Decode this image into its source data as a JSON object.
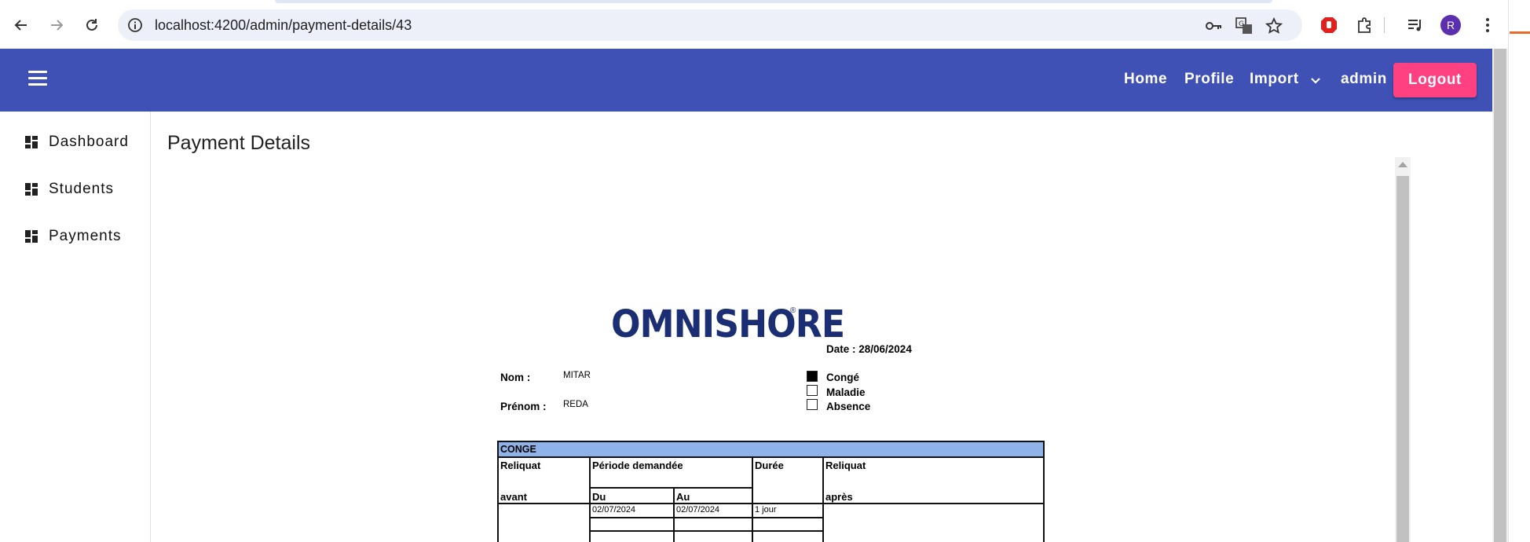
{
  "browser": {
    "url": "localhost:4200/admin/payment-details/43",
    "avatar_letter": "R",
    "icons": [
      "back-icon",
      "forward-icon",
      "reload-icon",
      "site-info-icon",
      "password-key-icon",
      "translate-icon",
      "bookmark-star-icon",
      "adblock-icon",
      "extensions-icon",
      "media-control-icon",
      "profile-avatar",
      "more-menu-icon"
    ]
  },
  "appbar": {
    "nav": {
      "home": "Home",
      "profile": "Profile",
      "import": "Import",
      "user": "admin",
      "logout": "Logout"
    },
    "colors": {
      "primary": "#3f51b5",
      "accent": "#ff4081"
    }
  },
  "sidebar": {
    "items": [
      {
        "label": "Dashboard",
        "icon": "dashboard-icon"
      },
      {
        "label": "Students",
        "icon": "dashboard-icon"
      },
      {
        "label": "Payments",
        "icon": "dashboard-icon"
      }
    ]
  },
  "main": {
    "title": "Payment Details"
  },
  "document": {
    "logo": "OMNISHORE",
    "logo_mark": "®",
    "date": "Date : 28/06/2024",
    "nom_label": "Nom :",
    "nom_value": "MITAR",
    "prenom_label": "Prénom :",
    "prenom_value": "REDA",
    "types": [
      {
        "label": "Congé",
        "checked": true
      },
      {
        "label": "Maladie",
        "checked": false
      },
      {
        "label": "Absence",
        "checked": false
      }
    ],
    "table": {
      "section": "CONGE",
      "reliquat_avant_1": "Reliquat",
      "reliquat_avant_2": "avant",
      "periode": "Période demandée",
      "du": "Du",
      "au": "Au",
      "duree": "Durée",
      "reliquat_apres_1": "Reliquat",
      "reliquat_apres_2": "après",
      "row1": {
        "du": "02/07/2024",
        "au": "02/07/2024",
        "duree": "1 jour"
      },
      "header_color": "#8fb3e8"
    }
  }
}
